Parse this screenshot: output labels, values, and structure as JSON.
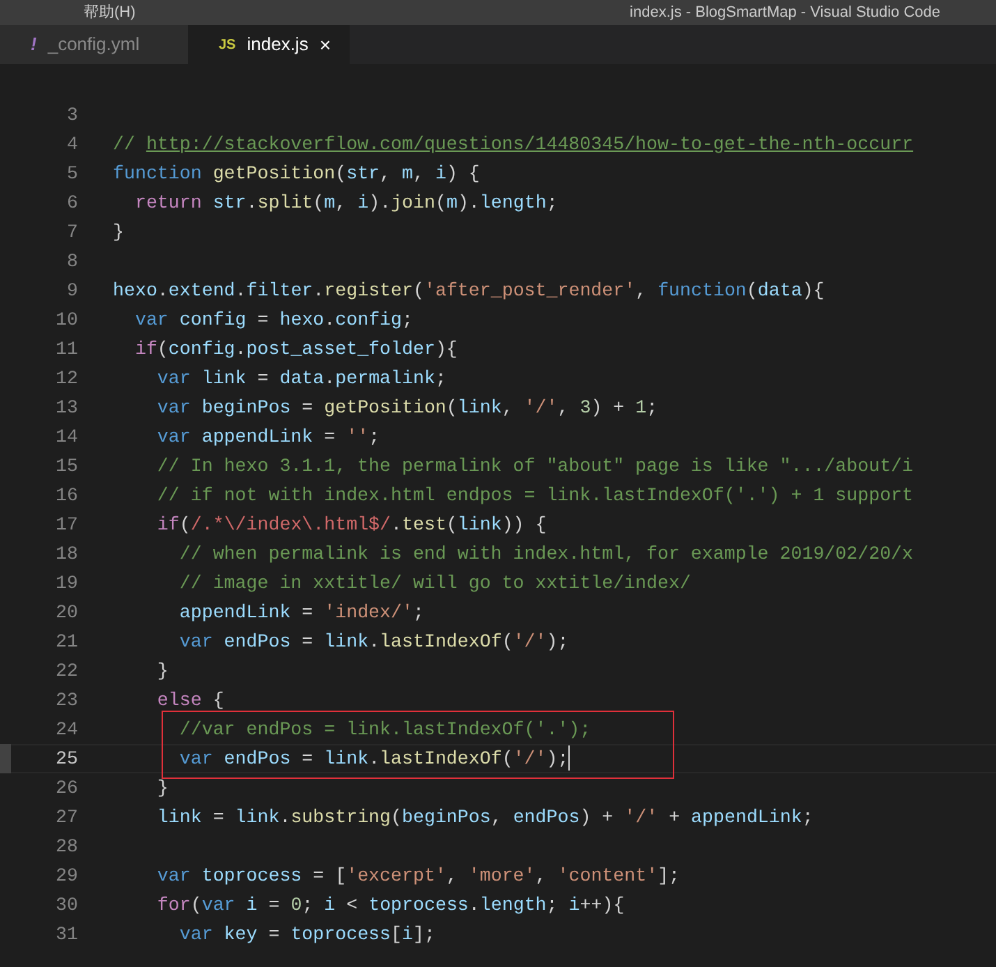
{
  "menu": {
    "label": "帮助(H)"
  },
  "window": {
    "title": "index.js - BlogSmartMap - Visual Studio Code"
  },
  "tabs": [
    {
      "icon": "!",
      "label": "_config.yml",
      "selected": false
    },
    {
      "icon": "JS",
      "label": "index.js",
      "selected": true,
      "close": "×"
    }
  ],
  "lines": [
    {
      "number": "3"
    },
    {
      "number": "4",
      "tokens": [
        {
          "t": "// ",
          "kind": "cmt"
        },
        {
          "t": "http://stackoverflow.com/questions/14480345/how-to-get-the-nth-occurr",
          "kind": "link"
        }
      ]
    },
    {
      "number": "5",
      "tokens": [
        {
          "t": "function ",
          "kind": "kw"
        },
        {
          "t": "getPosition",
          "kind": "fn"
        },
        {
          "t": "(",
          "kind": "p"
        },
        {
          "t": "str",
          "kind": "var"
        },
        {
          "t": ", ",
          "kind": "p"
        },
        {
          "t": "m",
          "kind": "var"
        },
        {
          "t": ", ",
          "kind": "p"
        },
        {
          "t": "i",
          "kind": "var"
        },
        {
          "t": ") {",
          "kind": "p"
        }
      ]
    },
    {
      "number": "6",
      "tokens": [
        {
          "t": "  return ",
          "kind": "ctrl"
        },
        {
          "t": "str",
          "kind": "var"
        },
        {
          "t": ".",
          "kind": "p"
        },
        {
          "t": "split",
          "kind": "fn"
        },
        {
          "t": "(",
          "kind": "p"
        },
        {
          "t": "m",
          "kind": "var"
        },
        {
          "t": ", ",
          "kind": "p"
        },
        {
          "t": "i",
          "kind": "var"
        },
        {
          "t": ").",
          "kind": "p"
        },
        {
          "t": "join",
          "kind": "fn"
        },
        {
          "t": "(",
          "kind": "p"
        },
        {
          "t": "m",
          "kind": "var"
        },
        {
          "t": ").",
          "kind": "p"
        },
        {
          "t": "length",
          "kind": "var"
        },
        {
          "t": ";",
          "kind": "p"
        }
      ]
    },
    {
      "number": "7",
      "tokens": [
        {
          "t": "}",
          "kind": "p"
        }
      ]
    },
    {
      "number": "8"
    },
    {
      "number": "9",
      "tokens": [
        {
          "t": "hexo",
          "kind": "var"
        },
        {
          "t": ".",
          "kind": "p"
        },
        {
          "t": "extend",
          "kind": "var"
        },
        {
          "t": ".",
          "kind": "p"
        },
        {
          "t": "filter",
          "kind": "var"
        },
        {
          "t": ".",
          "kind": "p"
        },
        {
          "t": "register",
          "kind": "fn"
        },
        {
          "t": "(",
          "kind": "p"
        },
        {
          "t": "'after_post_render'",
          "kind": "str"
        },
        {
          "t": ", ",
          "kind": "p"
        },
        {
          "t": "function",
          "kind": "kw"
        },
        {
          "t": "(",
          "kind": "p"
        },
        {
          "t": "data",
          "kind": "var"
        },
        {
          "t": "){",
          "kind": "p"
        }
      ]
    },
    {
      "number": "10",
      "tokens": [
        {
          "t": "  var ",
          "kind": "kw"
        },
        {
          "t": "config",
          "kind": "var"
        },
        {
          "t": " = ",
          "kind": "p"
        },
        {
          "t": "hexo",
          "kind": "var"
        },
        {
          "t": ".",
          "kind": "p"
        },
        {
          "t": "config",
          "kind": "var"
        },
        {
          "t": ";",
          "kind": "p"
        }
      ]
    },
    {
      "number": "11",
      "tokens": [
        {
          "t": "  if",
          "kind": "ctrl"
        },
        {
          "t": "(",
          "kind": "p"
        },
        {
          "t": "config",
          "kind": "var"
        },
        {
          "t": ".",
          "kind": "p"
        },
        {
          "t": "post_asset_folder",
          "kind": "var"
        },
        {
          "t": "){",
          "kind": "p"
        }
      ]
    },
    {
      "number": "12",
      "tokens": [
        {
          "t": "    var ",
          "kind": "kw"
        },
        {
          "t": "link",
          "kind": "var"
        },
        {
          "t": " = ",
          "kind": "p"
        },
        {
          "t": "data",
          "kind": "var"
        },
        {
          "t": ".",
          "kind": "p"
        },
        {
          "t": "permalink",
          "kind": "var"
        },
        {
          "t": ";",
          "kind": "p"
        }
      ]
    },
    {
      "number": "13",
      "tokens": [
        {
          "t": "    var ",
          "kind": "kw"
        },
        {
          "t": "beginPos",
          "kind": "var"
        },
        {
          "t": " = ",
          "kind": "p"
        },
        {
          "t": "getPosition",
          "kind": "fn"
        },
        {
          "t": "(",
          "kind": "p"
        },
        {
          "t": "link",
          "kind": "var"
        },
        {
          "t": ", ",
          "kind": "p"
        },
        {
          "t": "'/'",
          "kind": "str"
        },
        {
          "t": ", ",
          "kind": "p"
        },
        {
          "t": "3",
          "kind": "num"
        },
        {
          "t": ") + ",
          "kind": "p"
        },
        {
          "t": "1",
          "kind": "num"
        },
        {
          "t": ";",
          "kind": "p"
        }
      ]
    },
    {
      "number": "14",
      "tokens": [
        {
          "t": "    var ",
          "kind": "kw"
        },
        {
          "t": "appendLink",
          "kind": "var"
        },
        {
          "t": " = ",
          "kind": "p"
        },
        {
          "t": "''",
          "kind": "str"
        },
        {
          "t": ";",
          "kind": "p"
        }
      ]
    },
    {
      "number": "15",
      "tokens": [
        {
          "t": "    // In hexo 3.1.1, the permalink of \"about\" page is like \".../about/i",
          "kind": "cmt"
        }
      ]
    },
    {
      "number": "16",
      "tokens": [
        {
          "t": "    // if not with index.html endpos = link.lastIndexOf('.') + 1 support",
          "kind": "cmt"
        }
      ]
    },
    {
      "number": "17",
      "tokens": [
        {
          "t": "    if",
          "kind": "ctrl"
        },
        {
          "t": "(",
          "kind": "p"
        },
        {
          "t": "/.*\\/index\\.html$/",
          "kind": "regex"
        },
        {
          "t": ".",
          "kind": "p"
        },
        {
          "t": "test",
          "kind": "fn"
        },
        {
          "t": "(",
          "kind": "p"
        },
        {
          "t": "link",
          "kind": "var"
        },
        {
          "t": ")) {",
          "kind": "p"
        }
      ]
    },
    {
      "number": "18",
      "tokens": [
        {
          "t": "      // when permalink is end with index.html, for example 2019/02/20/x",
          "kind": "cmt"
        }
      ]
    },
    {
      "number": "19",
      "tokens": [
        {
          "t": "      // image in xxtitle/ will go to xxtitle/index/",
          "kind": "cmt"
        }
      ]
    },
    {
      "number": "20",
      "tokens": [
        {
          "t": "      appendLink",
          "kind": "var"
        },
        {
          "t": " = ",
          "kind": "p"
        },
        {
          "t": "'index/'",
          "kind": "str"
        },
        {
          "t": ";",
          "kind": "p"
        }
      ]
    },
    {
      "number": "21",
      "tokens": [
        {
          "t": "      var ",
          "kind": "kw"
        },
        {
          "t": "endPos",
          "kind": "var"
        },
        {
          "t": " = ",
          "kind": "p"
        },
        {
          "t": "link",
          "kind": "var"
        },
        {
          "t": ".",
          "kind": "p"
        },
        {
          "t": "lastIndexOf",
          "kind": "fn"
        },
        {
          "t": "(",
          "kind": "p"
        },
        {
          "t": "'/'",
          "kind": "str"
        },
        {
          "t": ");",
          "kind": "p"
        }
      ]
    },
    {
      "number": "22",
      "tokens": [
        {
          "t": "    }",
          "kind": "p"
        }
      ]
    },
    {
      "number": "23",
      "tokens": [
        {
          "t": "    else ",
          "kind": "ctrl"
        },
        {
          "t": "{",
          "kind": "p"
        }
      ]
    },
    {
      "number": "24",
      "boxed": true,
      "current": false,
      "tokens": [
        {
          "t": "      //var endPos = link.lastIndexOf('.');",
          "kind": "cmt"
        }
      ]
    },
    {
      "number": "25",
      "boxed": true,
      "current": true,
      "tokens": [
        {
          "t": "      var ",
          "kind": "kw"
        },
        {
          "t": "endPos",
          "kind": "var"
        },
        {
          "t": " = ",
          "kind": "p"
        },
        {
          "t": "link",
          "kind": "var"
        },
        {
          "t": ".",
          "kind": "p"
        },
        {
          "t": "lastIndexOf",
          "kind": "fn"
        },
        {
          "t": "(",
          "kind": "p"
        },
        {
          "t": "'/'",
          "kind": "str"
        },
        {
          "t": ");",
          "kind": "p"
        }
      ]
    },
    {
      "number": "26",
      "tokens": [
        {
          "t": "    }",
          "kind": "p"
        }
      ]
    },
    {
      "number": "27",
      "tokens": [
        {
          "t": "    link",
          "kind": "var"
        },
        {
          "t": " = ",
          "kind": "p"
        },
        {
          "t": "link",
          "kind": "var"
        },
        {
          "t": ".",
          "kind": "p"
        },
        {
          "t": "substring",
          "kind": "fn"
        },
        {
          "t": "(",
          "kind": "p"
        },
        {
          "t": "beginPos",
          "kind": "var"
        },
        {
          "t": ", ",
          "kind": "p"
        },
        {
          "t": "endPos",
          "kind": "var"
        },
        {
          "t": ") + ",
          "kind": "p"
        },
        {
          "t": "'/'",
          "kind": "str"
        },
        {
          "t": " + ",
          "kind": "p"
        },
        {
          "t": "appendLink",
          "kind": "var"
        },
        {
          "t": ";",
          "kind": "p"
        }
      ]
    },
    {
      "number": "28"
    },
    {
      "number": "29",
      "tokens": [
        {
          "t": "    var ",
          "kind": "kw"
        },
        {
          "t": "toprocess",
          "kind": "var"
        },
        {
          "t": " = [",
          "kind": "p"
        },
        {
          "t": "'excerpt'",
          "kind": "str"
        },
        {
          "t": ", ",
          "kind": "p"
        },
        {
          "t": "'more'",
          "kind": "str"
        },
        {
          "t": ", ",
          "kind": "p"
        },
        {
          "t": "'content'",
          "kind": "str"
        },
        {
          "t": "];",
          "kind": "p"
        }
      ]
    },
    {
      "number": "30",
      "tokens": [
        {
          "t": "    for",
          "kind": "ctrl"
        },
        {
          "t": "(",
          "kind": "p"
        },
        {
          "t": "var ",
          "kind": "kw"
        },
        {
          "t": "i",
          "kind": "var"
        },
        {
          "t": " = ",
          "kind": "p"
        },
        {
          "t": "0",
          "kind": "num"
        },
        {
          "t": "; ",
          "kind": "p"
        },
        {
          "t": "i",
          "kind": "var"
        },
        {
          "t": " < ",
          "kind": "p"
        },
        {
          "t": "toprocess",
          "kind": "var"
        },
        {
          "t": ".",
          "kind": "p"
        },
        {
          "t": "length",
          "kind": "var"
        },
        {
          "t": "; ",
          "kind": "p"
        },
        {
          "t": "i",
          "kind": "var"
        },
        {
          "t": "++){",
          "kind": "p"
        }
      ]
    },
    {
      "number": "31",
      "tokens": [
        {
          "t": "      var ",
          "kind": "kw"
        },
        {
          "t": "key",
          "kind": "var"
        },
        {
          "t": " = ",
          "kind": "p"
        },
        {
          "t": "toprocess",
          "kind": "var"
        },
        {
          "t": "[",
          "kind": "p"
        },
        {
          "t": "i",
          "kind": "var"
        },
        {
          "t": "];",
          "kind": "p"
        }
      ]
    }
  ]
}
